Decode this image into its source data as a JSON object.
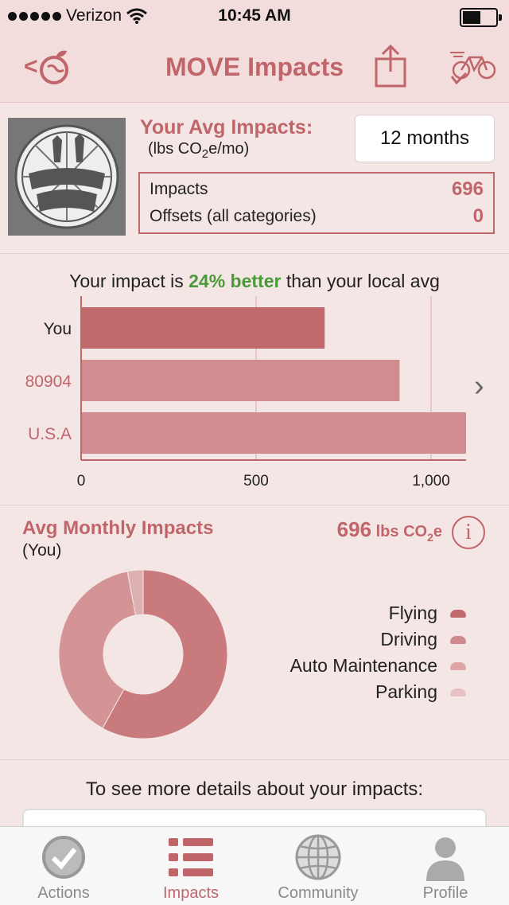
{
  "status_bar": {
    "carrier": "Verizon",
    "time": "10:45 AM"
  },
  "nav": {
    "back_label": "<",
    "title": "MOVE Impacts"
  },
  "summary": {
    "heading": "Your Avg Impacts:",
    "units_prefix": "(lbs CO",
    "units_sub": "2",
    "units_suffix": "e/mo)",
    "period": "12 months",
    "rows": [
      {
        "label": "Impacts",
        "value": "696"
      },
      {
        "label": "Offsets (all categories)",
        "value": "0"
      }
    ],
    "badge_text": [
      "CLIMATE",
      "HERO!"
    ]
  },
  "comparison": {
    "headline_prefix": "Your impact is ",
    "headline_highlight": "24% better",
    "headline_suffix": " than your local avg"
  },
  "chart_data": {
    "type": "bar",
    "orientation": "horizontal",
    "categories": [
      "You",
      "80904",
      "U.S.A"
    ],
    "values": [
      696,
      910,
      1100
    ],
    "xlim": [
      0,
      1100
    ],
    "ticks": [
      0,
      500,
      1000
    ],
    "tick_labels": [
      "0",
      "500",
      "1,000"
    ],
    "grid": true,
    "colors": [
      "#c06a6e",
      "#d08c8e",
      "#d08c8e"
    ]
  },
  "breakdown": {
    "title": "Avg Monthly Impacts",
    "subtitle": "(You)",
    "total_value": "696",
    "total_unit_prefix": " lbs CO",
    "total_unit_sub": "2",
    "total_unit_suffix": "e",
    "info_icon": "i",
    "legend": [
      {
        "label": "Flying",
        "color": "#c06a6e"
      },
      {
        "label": "Driving",
        "color": "#cf8a8c"
      },
      {
        "label": "Auto Maintenance",
        "color": "#dca5a6"
      },
      {
        "label": "Parking",
        "color": "#e8c2c3"
      }
    ],
    "donut_shares": [
      0.58,
      0.39,
      0.03,
      0.0
    ],
    "donut_colors": [
      "#c97a7d",
      "#d49496",
      "#dcb0b1",
      "#e8c2c3"
    ]
  },
  "more": {
    "text": "To see more details about your impacts:"
  },
  "tabs": [
    {
      "label": "Actions",
      "icon": "checkmark-icon"
    },
    {
      "label": "Impacts",
      "icon": "list-icon"
    },
    {
      "label": "Community",
      "icon": "globe-icon"
    },
    {
      "label": "Profile",
      "icon": "person-icon"
    }
  ],
  "colors": {
    "accent": "#c0666a",
    "positive": "#4a9a3a",
    "background": "#f5e6e6"
  }
}
